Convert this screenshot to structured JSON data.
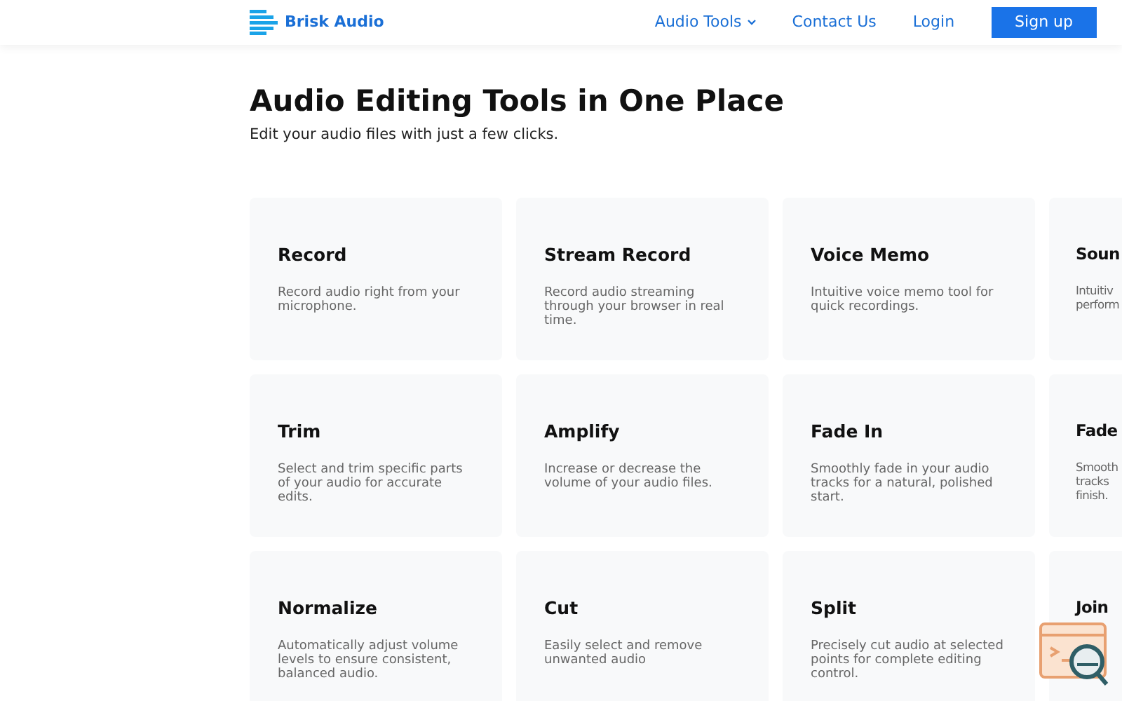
{
  "brand": "Brisk Audio",
  "nav": [
    {
      "label": "Audio Tools",
      "kind": "dropdown"
    },
    {
      "label": "Contact Us",
      "kind": "link"
    },
    {
      "label": "Login",
      "kind": "link"
    },
    {
      "label": "Sign up",
      "kind": "button"
    }
  ],
  "heading": "Audio Editing Tools in One Place",
  "subtitle": "Edit your audio files with just a few clicks.",
  "tools": [
    {
      "title": "Record",
      "description": [
        "Record audio right from your",
        "microphone."
      ]
    },
    {
      "title": "Stream Record",
      "description": [
        "Record audio streaming",
        "through your browser in real",
        "time."
      ]
    },
    {
      "title": "Voice Memo",
      "description": [
        "Intuitive voice memo tool for",
        "quick recordings."
      ]
    },
    {
      "title": "Soun",
      "description": [
        "Intuitiv",
        "perform"
      ]
    },
    {
      "title": "Trim",
      "description": [
        "Select and trim specific parts",
        "of your audio for accurate",
        "edits."
      ]
    },
    {
      "title": "Amplify",
      "description": [
        "Increase or decrease the",
        "volume of your audio files."
      ]
    },
    {
      "title": "Fade In",
      "description": [
        "Smoothly fade in your audio",
        "tracks for a natural, polished",
        "start."
      ]
    },
    {
      "title": "Fade",
      "description": [
        "Smooth",
        "tracks",
        "finish."
      ]
    },
    {
      "title": "Normalize",
      "description": [
        "Automatically adjust volume",
        "levels to ensure consistent,",
        "balanced audio."
      ]
    },
    {
      "title": "Cut",
      "description": [
        "Easily select and remove",
        "unwanted audio"
      ]
    },
    {
      "title": "Split",
      "description": [
        "Precisely cut audio at selected",
        "points for complete editing",
        "control."
      ]
    },
    {
      "title": "Join"
    }
  ]
}
